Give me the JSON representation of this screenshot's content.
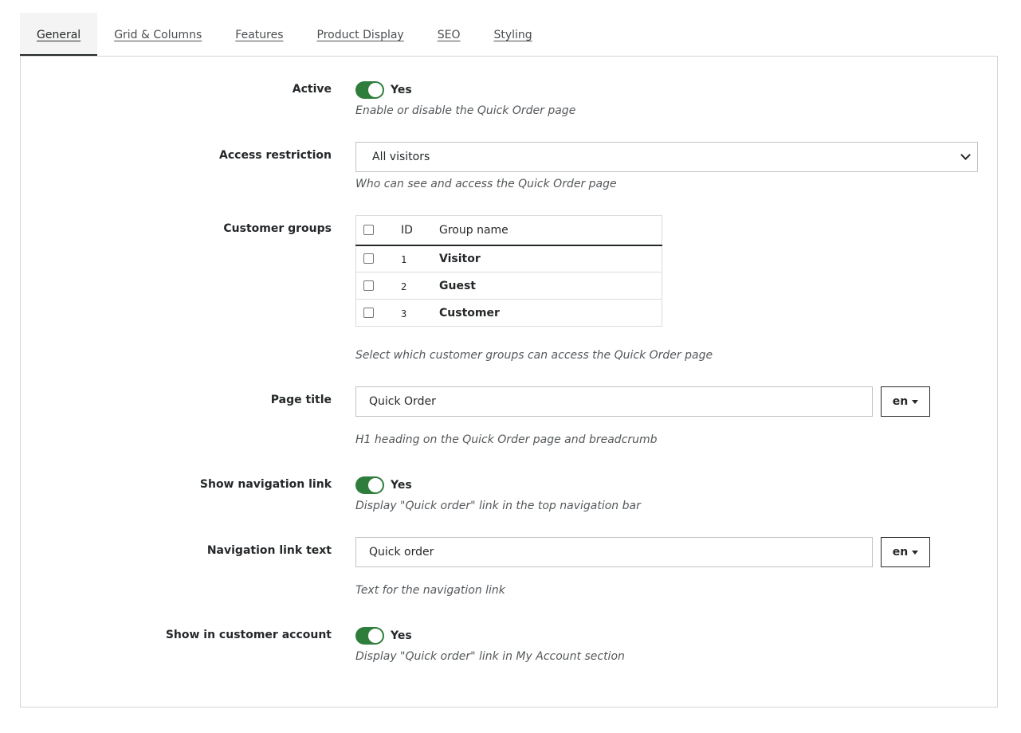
{
  "tabs": [
    {
      "label": "General",
      "active": true
    },
    {
      "label": "Grid & Columns"
    },
    {
      "label": "Features"
    },
    {
      "label": "Product Display"
    },
    {
      "label": "SEO"
    },
    {
      "label": "Styling"
    }
  ],
  "fields": {
    "active": {
      "label": "Active",
      "value": "Yes",
      "on": true,
      "help": "Enable or disable the Quick Order page"
    },
    "access": {
      "label": "Access restriction",
      "value": "All visitors",
      "help": "Who can see and access the Quick Order page"
    },
    "groups": {
      "label": "Customer groups",
      "columns": {
        "id": "ID",
        "name": "Group name"
      },
      "rows": [
        {
          "id": "1",
          "name": "Visitor",
          "checked": false
        },
        {
          "id": "2",
          "name": "Guest",
          "checked": false
        },
        {
          "id": "3",
          "name": "Customer",
          "checked": false
        }
      ],
      "help": "Select which customer groups can access the Quick Order page"
    },
    "page_title": {
      "label": "Page title",
      "value": "Quick Order",
      "lang": "en",
      "help": "H1 heading on the Quick Order page and breadcrumb"
    },
    "show_nav": {
      "label": "Show navigation link",
      "value": "Yes",
      "on": true,
      "help": "Display \"Quick order\" link in the top navigation bar"
    },
    "nav_text": {
      "label": "Navigation link text",
      "value": "Quick order",
      "lang": "en",
      "help": "Text for the navigation link"
    },
    "show_account": {
      "label": "Show in customer account",
      "value": "Yes",
      "on": true,
      "help": "Display \"Quick order\" link in My Account section"
    }
  },
  "colors": {
    "toggle_on": "#2f7d3b",
    "text": "#25282a",
    "help_text": "#54585b",
    "border": "#bfc2c5"
  },
  "icons": {
    "select": "chevron-down-icon",
    "lang": "caret-down-icon"
  }
}
